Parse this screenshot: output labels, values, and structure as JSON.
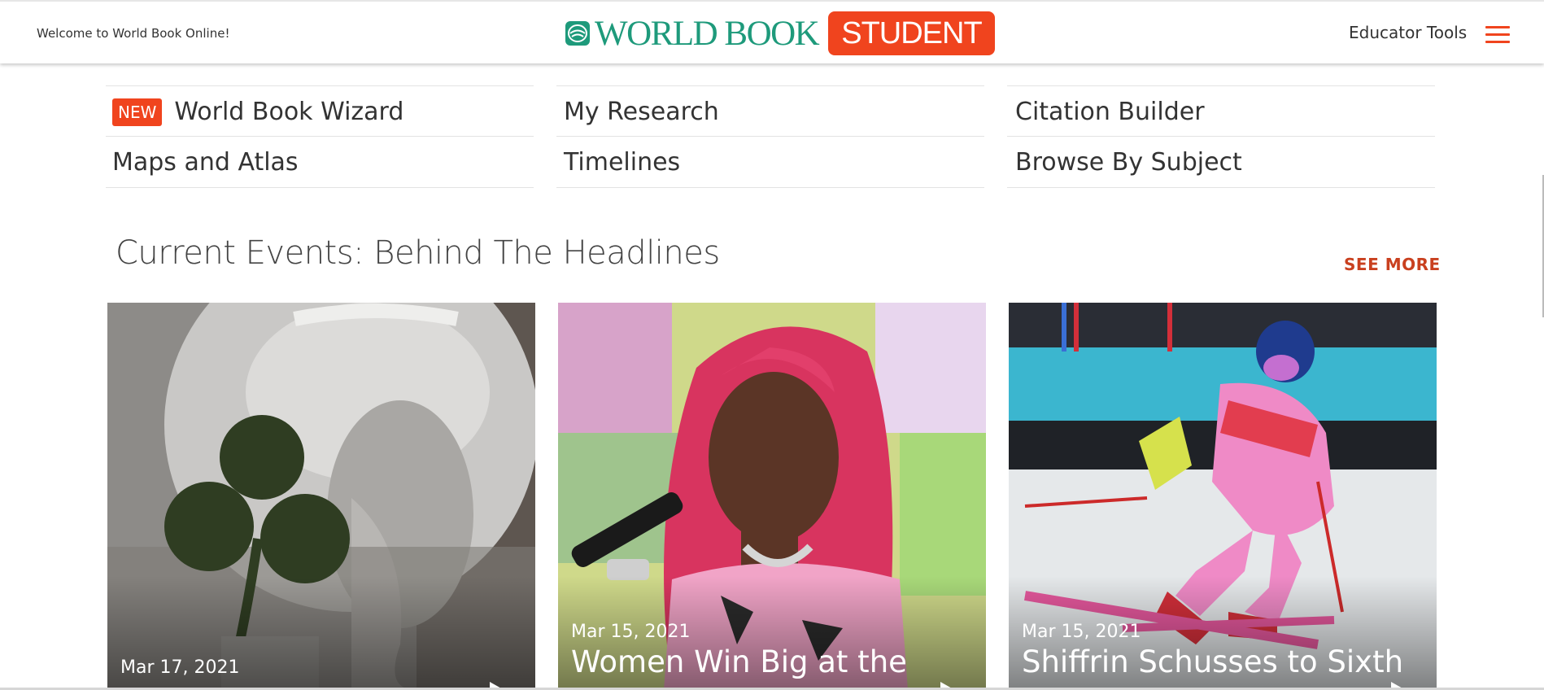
{
  "header": {
    "welcome": "Welcome to World Book Online!",
    "logo_text": "WORLD BOOK",
    "logo_badge": "STUDENT",
    "educator_tools": "Educator Tools",
    "menu_icon": "hamburger-icon"
  },
  "nav": {
    "new_badge": "NEW",
    "items": [
      {
        "label": "World Book Wizard"
      },
      {
        "label": "My Research"
      },
      {
        "label": "Citation Builder"
      },
      {
        "label": "Maps and Atlas"
      },
      {
        "label": "Timelines"
      },
      {
        "label": "Browse By Subject"
      }
    ]
  },
  "section": {
    "title": "Current Events: Behind The Headlines",
    "see_more": "SEE MORE"
  },
  "cards": [
    {
      "date": "Mar 17, 2021",
      "title": ""
    },
    {
      "date": "Mar 15, 2021",
      "title": "Women Win Big at the"
    },
    {
      "date": "Mar 15, 2021",
      "title": "Shiffrin Schusses to Sixth"
    }
  ],
  "colors": {
    "brand_green": "#1e9a7b",
    "accent_orange": "#f0441e",
    "see_more": "#c9401f"
  }
}
